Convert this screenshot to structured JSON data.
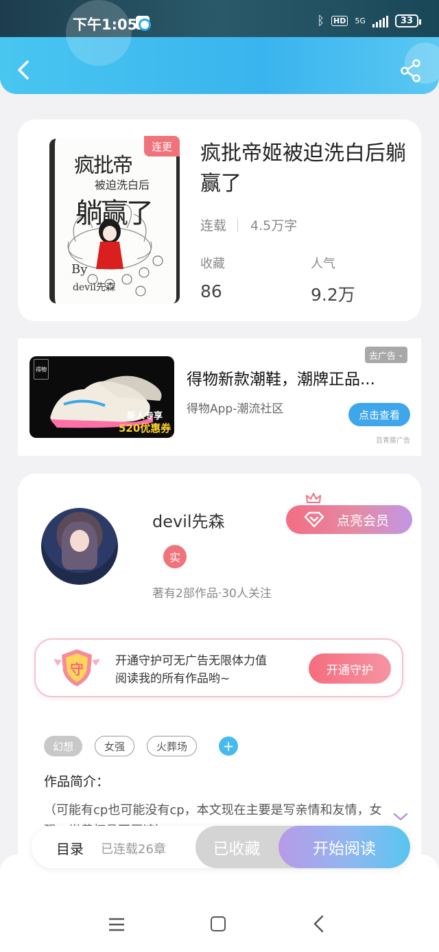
{
  "status_bar": {
    "time": "下午1:05",
    "network": "5G",
    "hd": "HD",
    "battery": "33",
    "icons": [
      "app-notification-icon",
      "bluetooth-icon",
      "signal-icon",
      "battery-icon"
    ]
  },
  "header": {
    "back_icon": "chevron-left-icon",
    "share_icon": "share-icon",
    "accent": "#3ab4ee"
  },
  "book": {
    "title": "疯批帝姬被迫洗白后躺赢了",
    "badge": "连更",
    "status": "连载",
    "word_count": "4.5万字",
    "stats": [
      {
        "label": "收藏",
        "value": "86"
      },
      {
        "label": "人气",
        "value": "9.2万"
      }
    ],
    "cover": {
      "line1": "疯批帝",
      "line2": "被迫洗白后",
      "line3": "躺赢了",
      "by": "By",
      "author": "devil先森"
    }
  },
  "ad": {
    "close_label": "去广告",
    "title": "得物新款潮鞋，潮牌正品...",
    "subtitle": "得物App-潮流社区",
    "button": "点击查看",
    "source": "百青藤广告",
    "image_tag": "得物",
    "promo_line1": "新人专享",
    "promo_line2": "520优惠券"
  },
  "author": {
    "name": "devil先森",
    "verified_badge": "实",
    "info": "著有2部作品·30人关注",
    "vip_button": "点亮会员",
    "guard": {
      "icon_text": "守",
      "text_line1": "开通守护可无广告无限体力值",
      "text_line2": "阅读我的所有作品哟~",
      "button": "开通守护"
    },
    "tags": [
      "幻想",
      "女强",
      "火葬场"
    ],
    "tag_add": "+",
    "intro_label": "作品简介：",
    "intro_text": "（可能有cp也可能没有cp，本文现在主要是写亲情和友情，女强，半黄杯具不原谅）"
  },
  "action_bar": {
    "toc": "目录",
    "toc_sub": "已连载26章",
    "favorite": "已收藏",
    "read": "开始阅读"
  },
  "nav_bar": {
    "icons": [
      "menu-icon",
      "home-icon",
      "back-icon"
    ]
  }
}
